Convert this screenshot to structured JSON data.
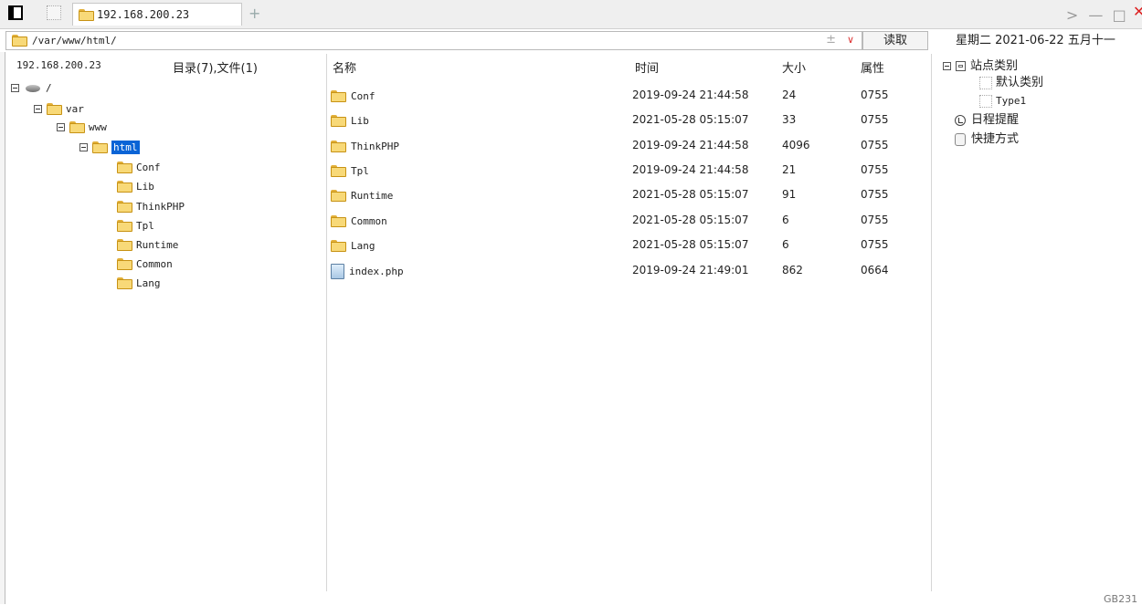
{
  "tabs": {
    "active_label": "192.168.200.23",
    "new_tab_glyph": "+"
  },
  "window": {
    "forward_glyph": ">",
    "minimize_glyph": "—",
    "maximize_glyph": "□",
    "close_glyph": "✕"
  },
  "address": {
    "path": "/var/www/html/",
    "plusminus": "±",
    "dropdown": "∨",
    "read_label": "读取"
  },
  "date": "星期二 2021-06-22 五月十一",
  "tree": {
    "host": "192.168.200.23",
    "summary": "目录(7),文件(1)",
    "root": "/",
    "var": "var",
    "www": "www",
    "html": "html",
    "children": [
      "Conf",
      "Lib",
      "ThinkPHP",
      "Tpl",
      "Runtime",
      "Common",
      "Lang"
    ]
  },
  "list": {
    "headers": {
      "name": "名称",
      "time": "时间",
      "size": "大小",
      "perm": "属性"
    },
    "rows": [
      {
        "name": "Conf",
        "time": "2019-09-24 21:44:58",
        "size": "24",
        "perm": "0755",
        "kind": "folder"
      },
      {
        "name": "Lib",
        "time": "2021-05-28 05:15:07",
        "size": "33",
        "perm": "0755",
        "kind": "folder"
      },
      {
        "name": "ThinkPHP",
        "time": "2019-09-24 21:44:58",
        "size": "4096",
        "perm": "0755",
        "kind": "folder"
      },
      {
        "name": "Tpl",
        "time": "2019-09-24 21:44:58",
        "size": "21",
        "perm": "0755",
        "kind": "folder"
      },
      {
        "name": "Runtime",
        "time": "2021-05-28 05:15:07",
        "size": "91",
        "perm": "0755",
        "kind": "folder"
      },
      {
        "name": "Common",
        "time": "2021-05-28 05:15:07",
        "size": "6",
        "perm": "0755",
        "kind": "folder"
      },
      {
        "name": "Lang",
        "time": "2021-05-28 05:15:07",
        "size": "6",
        "perm": "0755",
        "kind": "folder"
      },
      {
        "name": "index.php",
        "time": "2019-09-24 21:49:01",
        "size": "862",
        "perm": "0664",
        "kind": "file"
      }
    ]
  },
  "right_panel": {
    "site_category": "站点类别",
    "default_category": "默认类别",
    "type1": "Type1",
    "schedule": "日程提醒",
    "shortcuts": "快捷方式"
  },
  "corner_text": "GB231"
}
